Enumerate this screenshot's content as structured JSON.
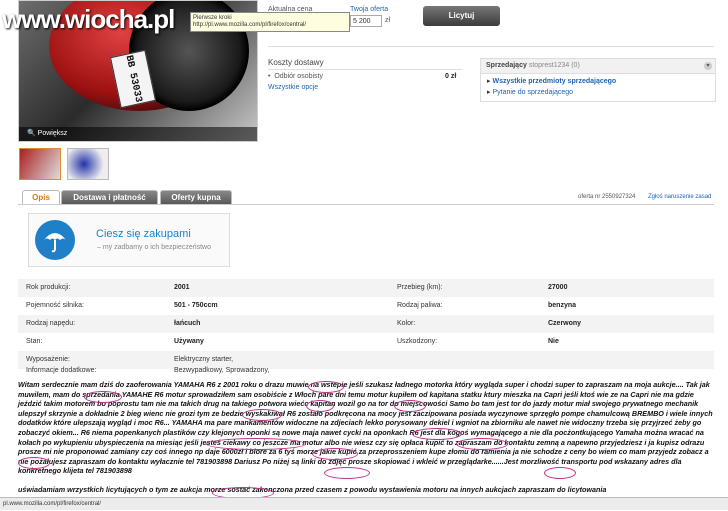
{
  "watermark": "www.wiocha.pl",
  "photo": {
    "plate_text": "BB 53033",
    "zoom_label": "Powiększ"
  },
  "tooltip": {
    "title": "Pierwsze kroki",
    "url": "http://pl.www.mozilla.com/pl/firefox/central/"
  },
  "offer": {
    "current_price_label": "Aktualna cena",
    "your_offer_label": "Twoja oferta",
    "your_offer_value": "5 200",
    "currency": "zł",
    "bid_button": "Licytuj"
  },
  "shipping": {
    "title": "Koszty dostawy",
    "option": "Odbiór osobisty",
    "price": "0 zł",
    "all_options": "Wszystkie opcje"
  },
  "seller": {
    "label": "Sprzedający",
    "name": "stoprest1234 (0)",
    "all_items": "Wszystkie przedmioty sprzedającego",
    "ask": "Pytanie do sprzedającego"
  },
  "tabs": [
    "Opis",
    "Dostawa i płatność",
    "Oferty kupna"
  ],
  "offer_number": "oferta nr 2550927324",
  "report": "Zgłoś naruszenie zasad",
  "happy": {
    "title": "Ciesz się zakupami",
    "subtitle": "my zadbamy o ich bezpieczeństwo"
  },
  "details": [
    {
      "l1": "Rok produkcji:",
      "v1": "2001",
      "l2": "Przebieg (km):",
      "v2": "27000"
    },
    {
      "l1": "Pojemność silnika:",
      "v1": "501 - 750ccm",
      "l2": "Rodzaj paliwa:",
      "v2": "benzyna"
    },
    {
      "l1": "Rodzaj napędu:",
      "v1": "łańcuch",
      "l2": "Kolor:",
      "v2": "Czerwony"
    },
    {
      "l1": "Stan:",
      "v1": "Używany",
      "l2": "Uszkodzony:",
      "v2": "Nie"
    },
    {
      "l1": "Wyposażenie:",
      "v1": "Elektryczny starter,",
      "l2": "",
      "v2": ""
    },
    {
      "l1": "Informacje dodatkowe:",
      "v1": "Bezwypadkowy, Sprowadzony,",
      "l2": "",
      "v2": ""
    }
  ],
  "description": {
    "p1": "Witam serdecznie mam dziś do zaoferowania YAMAHA R6 z 2001 roku o drazu muwie na wstepie jeśli szukasz ładnego motorka który wygląda super i chodzi super to zapraszam na moja aukcje.... Tak jak muwilem, mam do sprzedania YAMAHE R6 motur sprowadziłem sam osobiście z Włoch pare dni temu motur kupiłem od kapitana statku ktury mieszka na Capri jeśli ktoś wie ze na Capri nie ma gdzie jeździć takim motorem bo poprostu tam nie ma takich drug na takiego potwora wiećc kapitan wozil go na tor do miejscowości Samo bo tam jest tor do jazdy motur miał swojego prywatnego mechanik ulepszył skrzynie a dokładnie 2 bieg wienc nie grozi tym ze bedzie wyskakiwał R6 zostało podkręcona na mocy jest zaczipowana posiada wyczynowe sprzęgło pompe chamulcową BREMBO i wiele innych dodatków które ulepszają wygląd i moc R6... YAMAHA ma pare mankamentów widoczne na zdjeciach lekko porysowany dekiel i wgniot na zbiorniku ale nawet nie widoczny trzeba się przyjrzeć żeby go zobaczyć okiem... R6 niema popenkanych plastików czy klejonych oponki są nowe maja nawet cycki na oponkach R6 jest dla kogoś wymagającego a nie dla pocżontkującego Yamaha można wracać na kołach po wykupieniu ubyspieczenia na miesiąc jeśli jesteś ciekawy co jeszcze ma motur albo nie wiesz czy się opłaca kupić to zapraszam do kontaktu zemną a napewno przyjedziesz i ja kupisz odrazu prosze mi nie proponować zamiany czy coś innego np daje 6000zł i biore za 6 tyś morze jakie kupić za przeprosszeniem kupe złomu do ramienia ja nie schodze z ceny bo wiem co mam przyjedz zobacz a nie pożałujesz zapraszam do kontaktu wyłacznie tel 781903898 Dariusz Po niżej są linki do zdjęć prosze skopiować i wkleić w przeglądarke......Jest morzliwość transportu pod wskazany adres dla konkretnego klijeta tel 781903898",
    "p2": "uświadamiam wrzystkich licytujących o tym ze aukcja morze sostać zakonczona przed czasem z powodu wystawienia motoru na innych aukcjach zapraszam do licytowania"
  },
  "statusbar": "pl.www.mozilla.com/pl/firefox/central/"
}
